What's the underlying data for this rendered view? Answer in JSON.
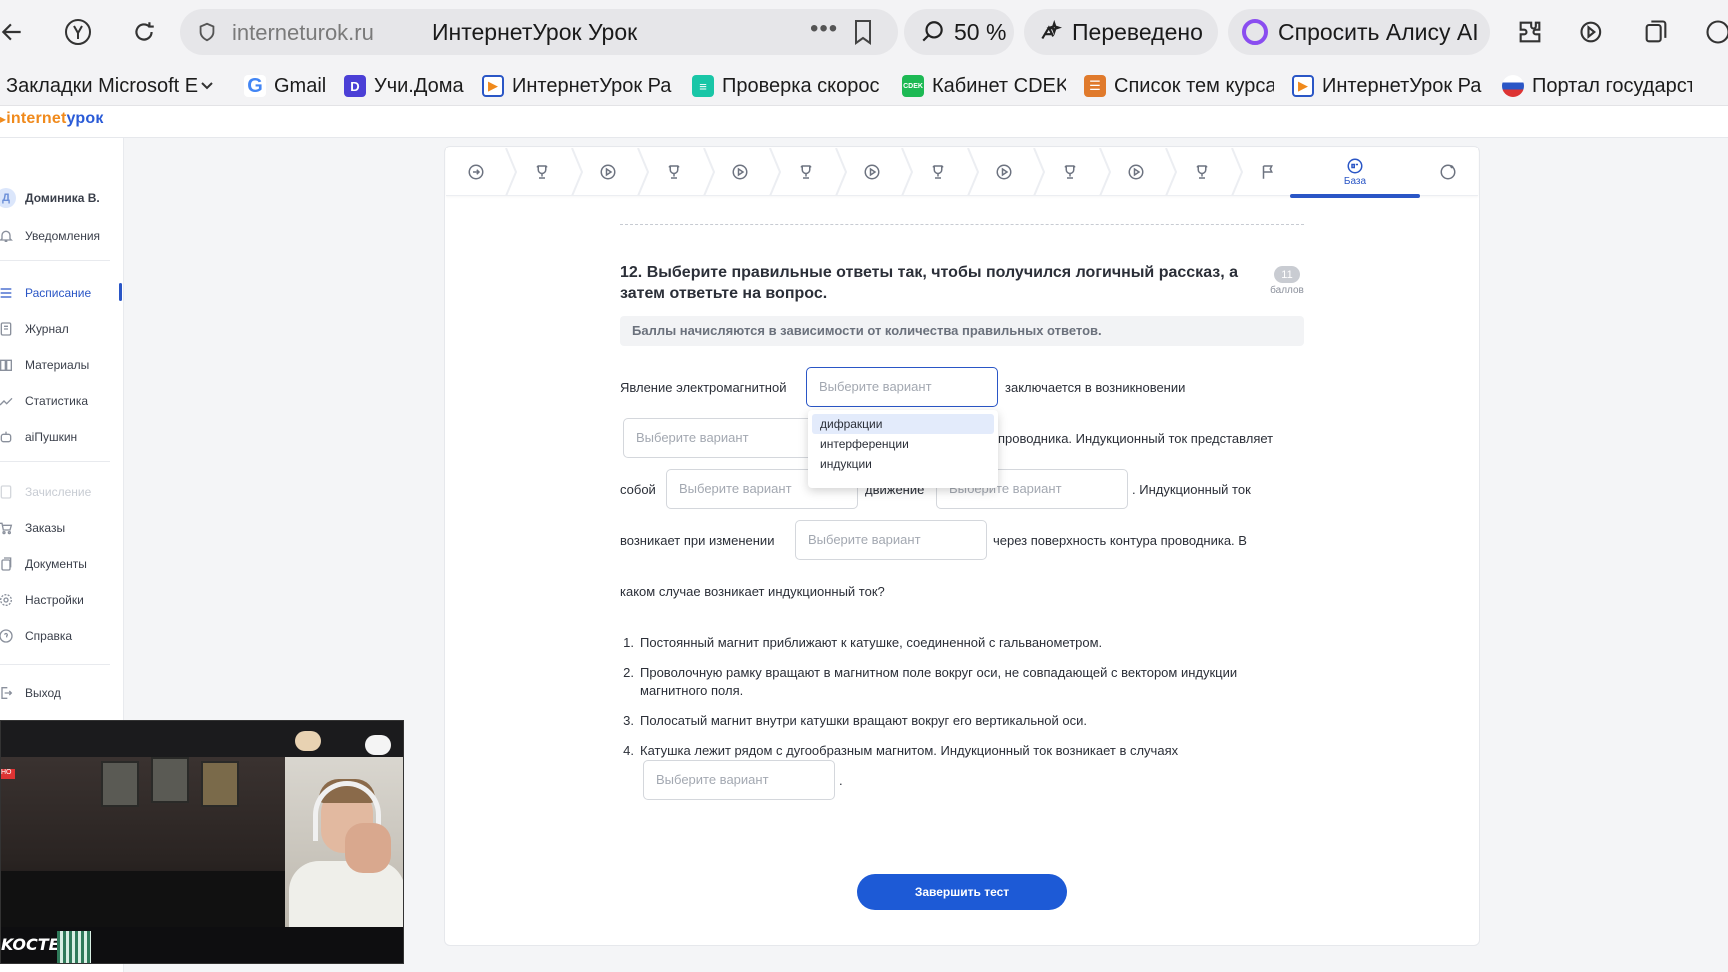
{
  "browser": {
    "domain": "interneturok.ru",
    "tab_title": "ИнтернетУрок Урок",
    "more_dots": "•••",
    "zoom": "50 %",
    "translated": "Переведено",
    "alice": "Спросить Алису AI"
  },
  "bookmarks": [
    {
      "label": "Закладки Microsoft E",
      "color": "#ffffff"
    },
    {
      "label": "Gmail",
      "color": "#ffffff"
    },
    {
      "label": "Учи.Дома",
      "color": "#4b3fd6"
    },
    {
      "label": "ИнтернетУрок Ра",
      "color": "#2a56c6"
    },
    {
      "label": "Проверка скорос",
      "color": "#19c6a7"
    },
    {
      "label": "Кабинет CDEK",
      "color": "#1db954"
    },
    {
      "label": "Список тем курса",
      "color": "#e07a2c"
    },
    {
      "label": "ИнтернетУрок Ра",
      "color": "#2a56c6"
    },
    {
      "label": "Портал государст",
      "color": "#d33"
    }
  ],
  "logo": {
    "part1": "internet",
    "part2": "урок"
  },
  "sidebar": {
    "avatar_letter": "Д",
    "user_name": "Доминика В.",
    "items": [
      {
        "label": "Уведомления",
        "icon": "bell-icon"
      },
      {
        "label": "Расписание",
        "icon": "list-icon"
      },
      {
        "label": "Журнал",
        "icon": "journal-icon"
      },
      {
        "label": "Материалы",
        "icon": "book-icon"
      },
      {
        "label": "Статистика",
        "icon": "chart-icon"
      },
      {
        "label": "aiПушкин",
        "icon": "robot-icon"
      },
      {
        "label": "Зачисление",
        "icon": "doc-icon"
      },
      {
        "label": "Заказы",
        "icon": "cart-icon"
      },
      {
        "label": "Документы",
        "icon": "documents-icon"
      },
      {
        "label": "Настройки",
        "icon": "gear-icon"
      },
      {
        "label": "Справка",
        "icon": "help-icon"
      },
      {
        "label": "Выход",
        "icon": "logout-icon"
      }
    ]
  },
  "steps": {
    "active_label": "База",
    "kinds": [
      "arrow",
      "trophy",
      "play",
      "trophy",
      "play",
      "trophy",
      "play",
      "trophy",
      "play",
      "trophy",
      "play",
      "trophy",
      "flag",
      "base",
      "plus"
    ]
  },
  "question": {
    "title": "12. Выберите правильные ответы так, чтобы получился логичный рассказ, а затем ответьте на вопрос.",
    "points": "11",
    "points_label": "баллов",
    "note": "Баллы начисляются в зависимости от количества правильных ответов.",
    "placeholder": "Выберите вариант",
    "line1_a": "Явление электромагнитной",
    "line1_b": "заключается в возникновении",
    "line2_b": "проводника. Индукционный ток представляет",
    "line3_a": "собой",
    "line3_b": "движение",
    "line3_c": ". Индукционный ток",
    "line4_a": "возникает при изменении",
    "line4_b": "через поверхность контура проводника. В",
    "line5": "каком случае возникает индукционный ток?",
    "dropdown_options": [
      "дифракции",
      "интерференции",
      "индукции"
    ],
    "list": [
      {
        "num": "1.",
        "text": "Постоянный магнит приближают к катушке, соединенной с гальванометром."
      },
      {
        "num": "2.",
        "text": "Проволочную рамку вращают в магнитном поле вокруг оси, не совпадающей с вектором индукции магнитного поля."
      },
      {
        "num": "3.",
        "text": "Полосатый магнит внутри катушки вращают вокруг его вертикальной оси."
      },
      {
        "num": "4.",
        "text": "Катушка лежит рядом с дугообразным магнитом. Индукционный ток возникает в случаях"
      }
    ],
    "final_dot": ".",
    "finish_button": "Завершить тест"
  },
  "webcam": {
    "tag": "KOCTEK",
    "live_badge": "НО"
  },
  "colors": {
    "accent": "#2a56c6",
    "button": "#1d5ad6",
    "logo_orange": "#f08a1c"
  }
}
